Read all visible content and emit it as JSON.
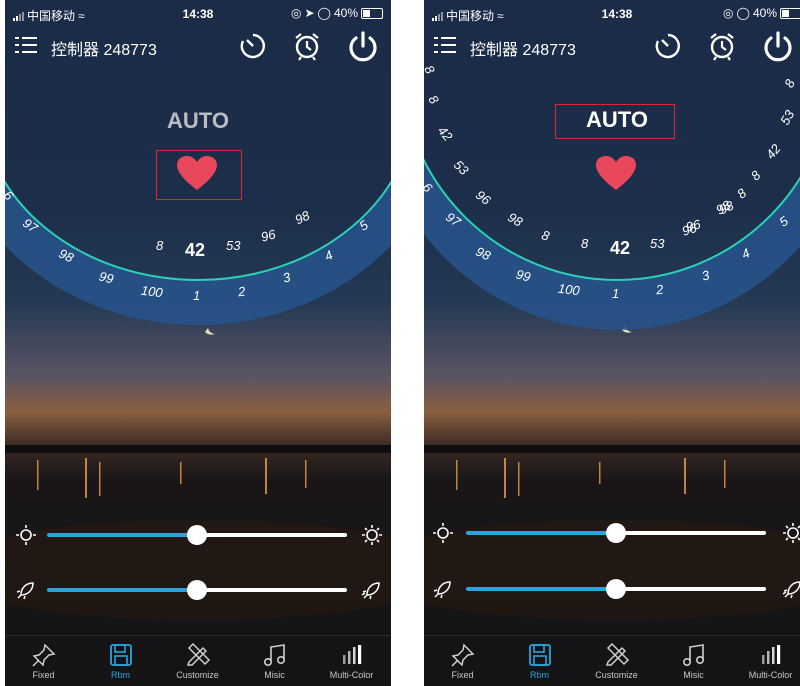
{
  "screens": [
    {
      "status": {
        "carrier": "中国移动",
        "time": "14:38",
        "battery": "40%"
      },
      "header": {
        "title": "控制器 248773"
      },
      "mode_label": "AUTO",
      "dial": {
        "inner_labels": [
          {
            "t": "8"
          },
          {
            "t": "42",
            "big": true
          },
          {
            "t": "53"
          },
          {
            "t": "96"
          },
          {
            "t": "98"
          },
          {
            "t": "5"
          },
          {
            "t": "97"
          },
          {
            "t": "6"
          }
        ],
        "outer_labels": [
          {
            "t": "98"
          },
          {
            "t": "99"
          },
          {
            "t": "100"
          },
          {
            "t": "1"
          },
          {
            "t": "2"
          },
          {
            "t": "3"
          },
          {
            "t": "4"
          }
        ]
      },
      "sliders": {
        "brightness": 0.5,
        "speed": 0.5
      },
      "tabs": [
        {
          "label": "Fixed",
          "icon": "pin-icon"
        },
        {
          "label": "Rbm",
          "icon": "save-icon",
          "active": true
        },
        {
          "label": "Customize",
          "icon": "pencil-ruler-icon"
        },
        {
          "label": "Misic",
          "icon": "music-note-icon"
        },
        {
          "label": "Multi-Color",
          "icon": "bars-icon"
        }
      ],
      "colors": {
        "accent": "#2aa3de",
        "heart": "#e9475b",
        "highlight_box": "#e0282a"
      }
    },
    {
      "status": {
        "carrier": "中国移动",
        "time": "14:38",
        "battery": "40%"
      },
      "header": {
        "title": "控制器 248773"
      },
      "mode_label": "AUTO",
      "dial": {
        "top_labels": [
          {
            "t": "8"
          },
          {
            "t": "8"
          },
          {
            "t": "42"
          },
          {
            "t": "53"
          },
          {
            "t": "96"
          },
          {
            "t": "98"
          },
          {
            "t": "8"
          },
          {
            "t": "8"
          },
          {
            "t": "98"
          },
          {
            "t": "96"
          },
          {
            "t": "53"
          },
          {
            "t": "42"
          },
          {
            "t": "8"
          },
          {
            "t": "8"
          }
        ],
        "inner_labels": [
          {
            "t": "8"
          },
          {
            "t": "42",
            "big": true
          },
          {
            "t": "53"
          },
          {
            "t": "96"
          },
          {
            "t": "98"
          },
          {
            "t": "5"
          },
          {
            "t": "97"
          },
          {
            "t": "6"
          }
        ],
        "outer_labels": [
          {
            "t": "98"
          },
          {
            "t": "99"
          },
          {
            "t": "100"
          },
          {
            "t": "1"
          },
          {
            "t": "2"
          },
          {
            "t": "3"
          },
          {
            "t": "4"
          }
        ]
      },
      "sliders": {
        "brightness": 0.5,
        "speed": 0.5
      },
      "tabs": [
        {
          "label": "Fixed",
          "icon": "pin-icon"
        },
        {
          "label": "Rbm",
          "icon": "save-icon",
          "active": true
        },
        {
          "label": "Customize",
          "icon": "pencil-ruler-icon"
        },
        {
          "label": "Misic",
          "icon": "music-note-icon"
        },
        {
          "label": "Multi-Color",
          "icon": "bars-icon"
        }
      ],
      "colors": {
        "accent": "#2aa3de",
        "heart": "#e9475b",
        "highlight_box": "#e0282a"
      }
    }
  ]
}
